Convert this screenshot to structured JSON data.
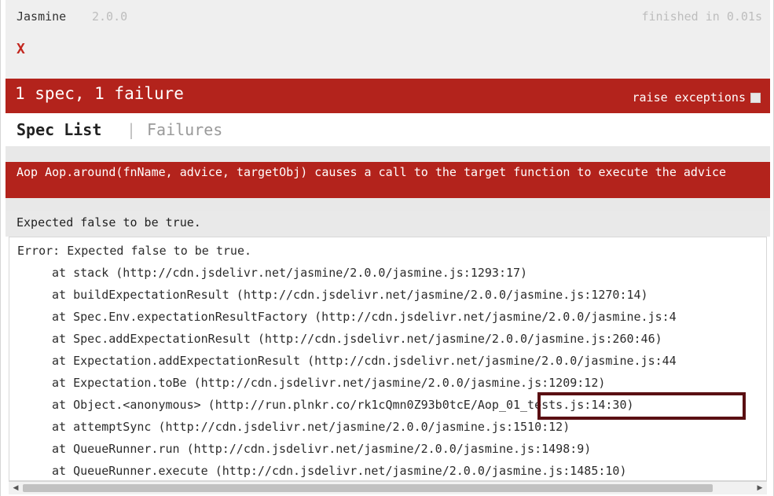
{
  "banner": {
    "title": "Jasmine",
    "version": "2.0.0",
    "duration": "finished in 0.01s"
  },
  "symbol_summary": {
    "failed_symbol": "X"
  },
  "bar": {
    "overall_result": "1 spec, 1 failure",
    "raise_exceptions_label": "raise exceptions",
    "raise_exceptions_checked": false
  },
  "menu": {
    "spec_list_label": "Spec List",
    "separator": "|",
    "failures_label": "Failures"
  },
  "failure": {
    "spec_name": "Aop Aop.around(fnName, advice, targetObj) causes a call to the target function to execute the advice",
    "result_message": "Expected false to be true.",
    "stack_trace": [
      "Error: Expected false to be true.",
      "at stack (http://cdn.jsdelivr.net/jasmine/2.0.0/jasmine.js:1293:17)",
      "at buildExpectationResult (http://cdn.jsdelivr.net/jasmine/2.0.0/jasmine.js:1270:14)",
      "at Spec.Env.expectationResultFactory (http://cdn.jsdelivr.net/jasmine/2.0.0/jasmine.js:4",
      "at Spec.addExpectationResult (http://cdn.jsdelivr.net/jasmine/2.0.0/jasmine.js:260:46)",
      "at Expectation.addExpectationResult (http://cdn.jsdelivr.net/jasmine/2.0.0/jasmine.js:44",
      "at Expectation.toBe (http://cdn.jsdelivr.net/jasmine/2.0.0/jasmine.js:1209:12)",
      "at Object.<anonymous> (http://run.plnkr.co/rk1cQmn0Z93b0tcE/Aop_01_tests.js:14:30)",
      "at attemptSync (http://cdn.jsdelivr.net/jasmine/2.0.0/jasmine.js:1510:12)",
      "at QueueRunner.run (http://cdn.jsdelivr.net/jasmine/2.0.0/jasmine.js:1498:9)",
      "at QueueRunner.execute (http://cdn.jsdelivr.net/jasmine/2.0.0/jasmine.js:1485:10)"
    ]
  },
  "colors": {
    "failure_red": "#b3231c",
    "highlight_border": "#5a0f12"
  }
}
